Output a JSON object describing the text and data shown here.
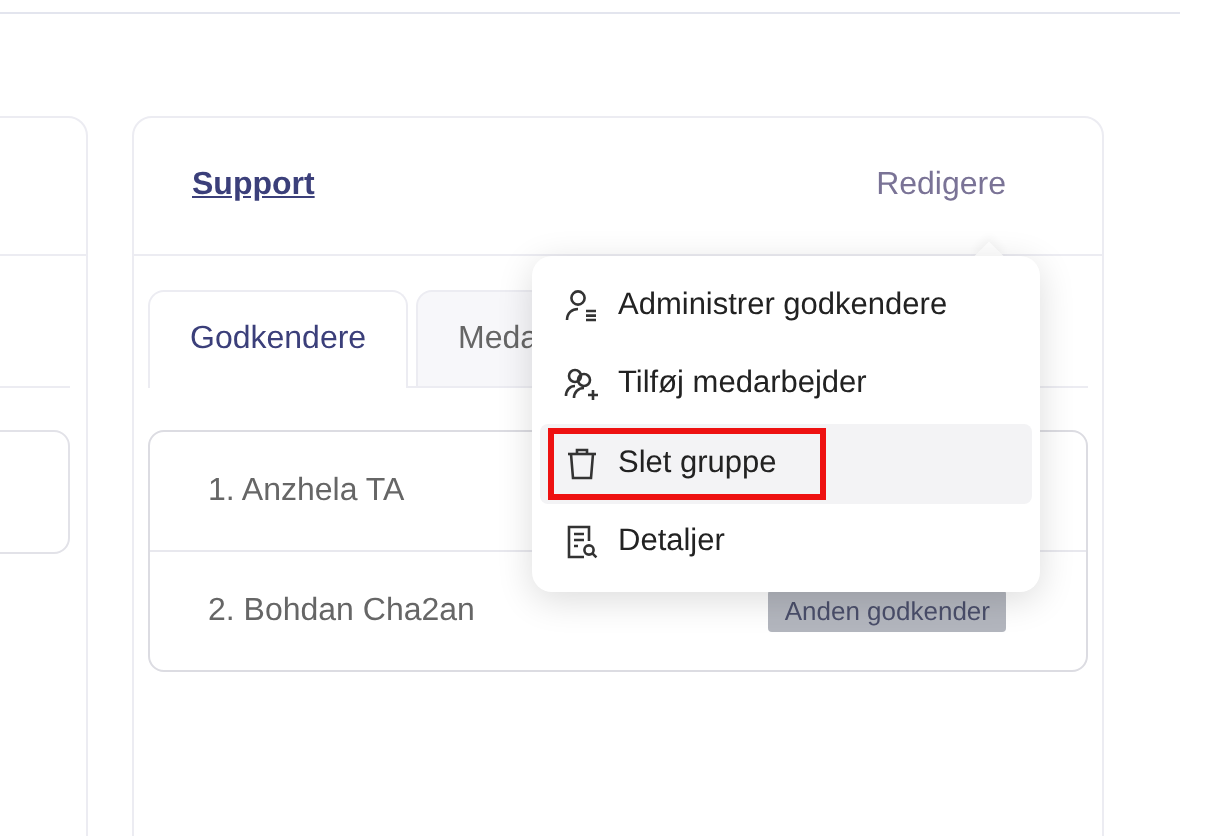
{
  "group_card": {
    "title": "Support",
    "edit_link": "Redigere",
    "tabs": [
      {
        "label": "Godkendere",
        "selected": true
      },
      {
        "label": "Meda",
        "selected": false
      }
    ],
    "approvers": [
      {
        "name": "1. Anzhela TA"
      },
      {
        "name": "2. Bohdan Cha2an",
        "badge": "Anden godkender"
      }
    ]
  },
  "menu": {
    "items": [
      {
        "kind": "manage",
        "label": "Administrer godkendere",
        "hovered": false,
        "outlined": false
      },
      {
        "kind": "add",
        "label": "Tilføj medarbejder",
        "hovered": false,
        "outlined": false
      },
      {
        "kind": "delete",
        "label": "Slet gruppe",
        "hovered": true,
        "outlined": true
      },
      {
        "kind": "details",
        "label": "Detaljer",
        "hovered": false,
        "outlined": false
      }
    ]
  }
}
